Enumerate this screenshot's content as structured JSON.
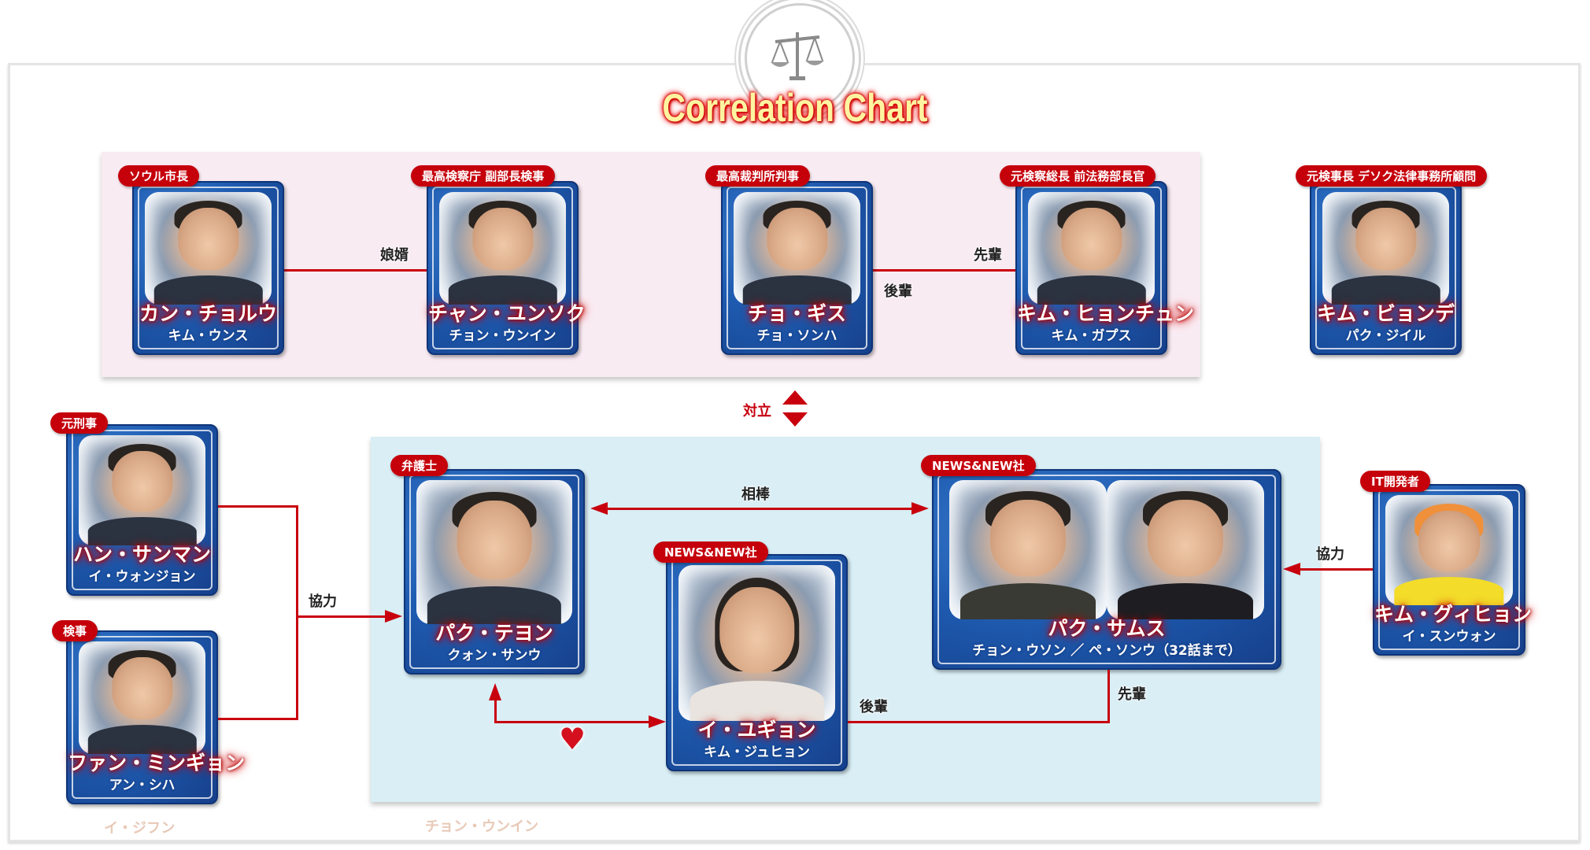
{
  "title": "Correlation Chart",
  "logo": {
    "icon": "scales-of-justice-icon"
  },
  "colors": {
    "accent_red": "#c8000e",
    "card_blue": "#1e5bb0",
    "panel_pink": "#f9ebf2",
    "panel_blue": "#d9eef5",
    "title_yellow": "#fff4a0"
  },
  "top_group": {
    "characters": [
      {
        "role": "ソウル市長",
        "name": "カン・チョルウ",
        "actor": "キム・ウンス"
      },
      {
        "role": "最高検察庁 副部長検事",
        "name": "チャン・ユンソク",
        "actor": "チョン・ウンイン"
      },
      {
        "role": "最高裁判所判事",
        "name": "チョ・ギス",
        "actor": "チョ・ソンハ"
      },
      {
        "role": "元検察総長 前法務部長官",
        "name": "キム・ヒョンチュン",
        "actor": "キム・ガプス"
      }
    ],
    "relations": [
      {
        "label": "娘婿"
      },
      {
        "label_left": "後輩",
        "label_right": "先輩"
      }
    ]
  },
  "independent": {
    "role": "元検事長 デソク法律事務所顧問",
    "name": "キム・ビョンデ",
    "actor": "パク・ジイル"
  },
  "opposition": {
    "label": "対立"
  },
  "left_group": {
    "characters": [
      {
        "role": "元刑事",
        "name": "ハン・サンマン",
        "actor": "イ・ウォンジョン"
      },
      {
        "role": "検事",
        "name": "ファン・ミンギョン",
        "actor": "アン・シハ"
      }
    ],
    "relation": {
      "label": "協力"
    }
  },
  "main_group": {
    "characters": [
      {
        "role": "弁護士",
        "name": "パク・テヨン",
        "actor": "クォン・サンウ"
      },
      {
        "role": "NEWS&NEW社",
        "name": "パク・サムス",
        "actor": "チョン・ウソン ／ ペ・ソンウ（32話まで）"
      },
      {
        "role": "NEWS&NEW社",
        "name": "イ・ユギョン",
        "actor": "キム・ジュヒョン"
      }
    ],
    "relations": {
      "partner": "相棒",
      "junior": "後輩",
      "senior": "先輩",
      "love_icon": "heart-icon"
    }
  },
  "right_character": {
    "role": "IT開発者",
    "name": "キム・グィヒョン",
    "actor": "イ・スンウォン",
    "relation": "協力"
  },
  "faded_captions": [
    "イ・ジフン",
    "チョン・ウンイン"
  ]
}
